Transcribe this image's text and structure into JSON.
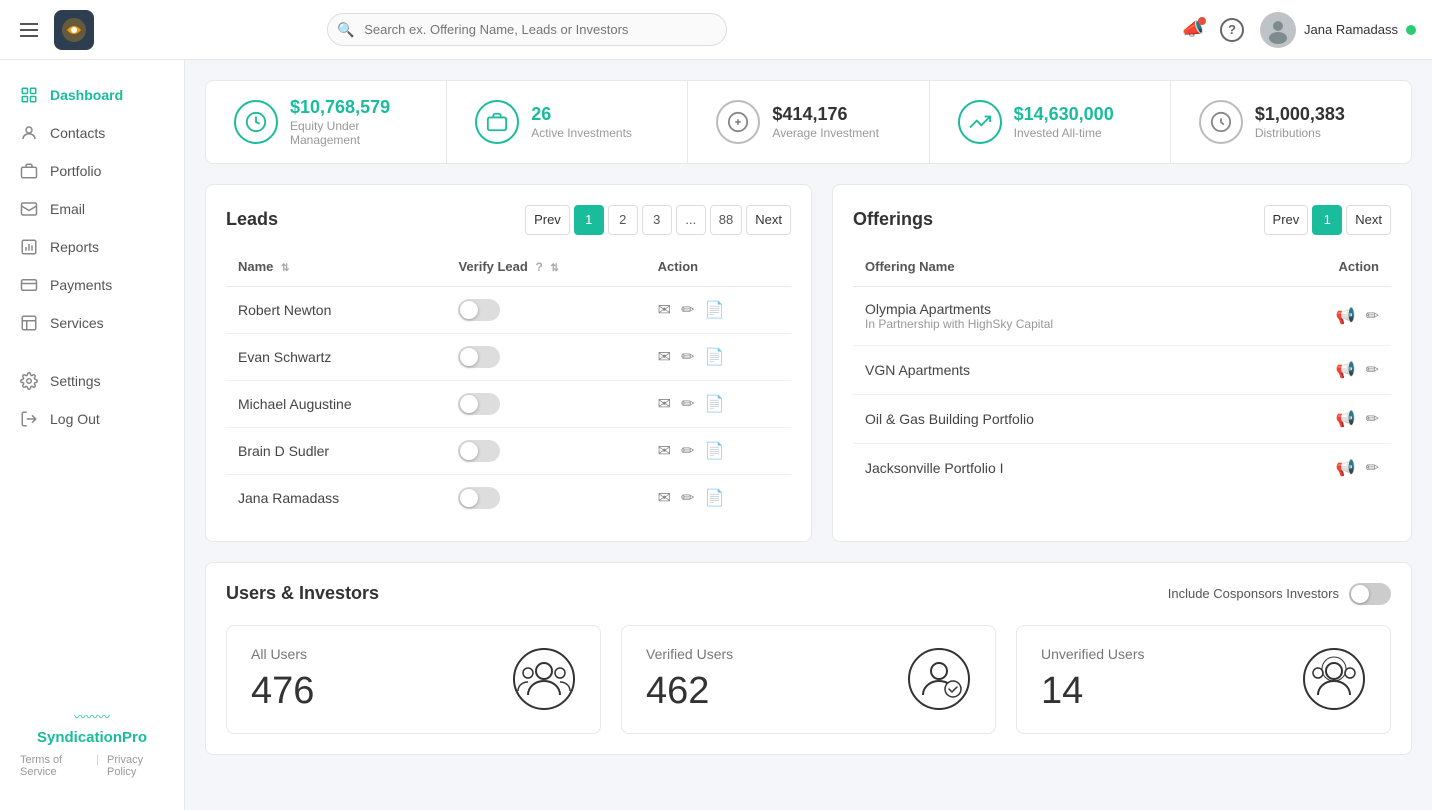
{
  "topbar": {
    "search_placeholder": "Search ex. Offering Name, Leads or Investors",
    "user_name": "Jana Ramadass"
  },
  "sidebar": {
    "items": [
      {
        "id": "dashboard",
        "label": "Dashboard",
        "active": true
      },
      {
        "id": "contacts",
        "label": "Contacts",
        "active": false
      },
      {
        "id": "portfolio",
        "label": "Portfolio",
        "active": false
      },
      {
        "id": "email",
        "label": "Email",
        "active": false
      },
      {
        "id": "reports",
        "label": "Reports",
        "active": false
      },
      {
        "id": "payments",
        "label": "Payments",
        "active": false
      },
      {
        "id": "services",
        "label": "Services",
        "active": false
      },
      {
        "id": "settings",
        "label": "Settings",
        "active": false
      },
      {
        "id": "logout",
        "label": "Log Out",
        "active": false
      }
    ],
    "footer": {
      "brand": "SyndicationPro",
      "terms": "Terms of Service",
      "privacy": "Privacy Policy"
    }
  },
  "stats": [
    {
      "id": "equity",
      "value": "$10,768,579",
      "label": "Equity Under Management",
      "color": "green"
    },
    {
      "id": "investments",
      "value": "26",
      "label": "Active Investments",
      "color": "green"
    },
    {
      "id": "average",
      "value": "$414,176",
      "label": "Average Investment",
      "color": "dark"
    },
    {
      "id": "invested",
      "value": "$14,630,000",
      "label": "Invested All-time",
      "color": "green"
    },
    {
      "id": "distributions",
      "value": "$1,000,383",
      "label": "Distributions",
      "color": "dark"
    }
  ],
  "leads": {
    "title": "Leads",
    "pagination": {
      "prev": "Prev",
      "next": "Next",
      "pages": [
        "1",
        "2",
        "3",
        "...",
        "88"
      ],
      "active": "1"
    },
    "columns": [
      "Name",
      "Verify Lead",
      "Action"
    ],
    "rows": [
      {
        "name": "Robert Newton"
      },
      {
        "name": "Evan Schwartz"
      },
      {
        "name": "Michael Augustine"
      },
      {
        "name": "Brain D Sudler"
      },
      {
        "name": "Jana Ramadass"
      }
    ]
  },
  "offerings": {
    "title": "Offerings",
    "pagination": {
      "prev": "Prev",
      "next": "Next",
      "active": "1"
    },
    "columns": [
      "Offering Name",
      "Action"
    ],
    "rows": [
      {
        "name": "Olympia Apartments",
        "sub": "In Partnership with HighSky Capital"
      },
      {
        "name": "VGN Apartments",
        "sub": ""
      },
      {
        "name": "Oil & Gas Building Portfolio",
        "sub": ""
      },
      {
        "name": "Jacksonville Portfolio I",
        "sub": ""
      }
    ]
  },
  "users_section": {
    "title": "Users & Investors",
    "toggle_label": "Include Cosponsors Investors",
    "cards": [
      {
        "id": "all-users",
        "title": "All Users",
        "value": "476"
      },
      {
        "id": "verified-users",
        "title": "Verified Users",
        "value": "462"
      },
      {
        "id": "unverified-users",
        "title": "Unverified Users",
        "value": "14"
      }
    ]
  }
}
